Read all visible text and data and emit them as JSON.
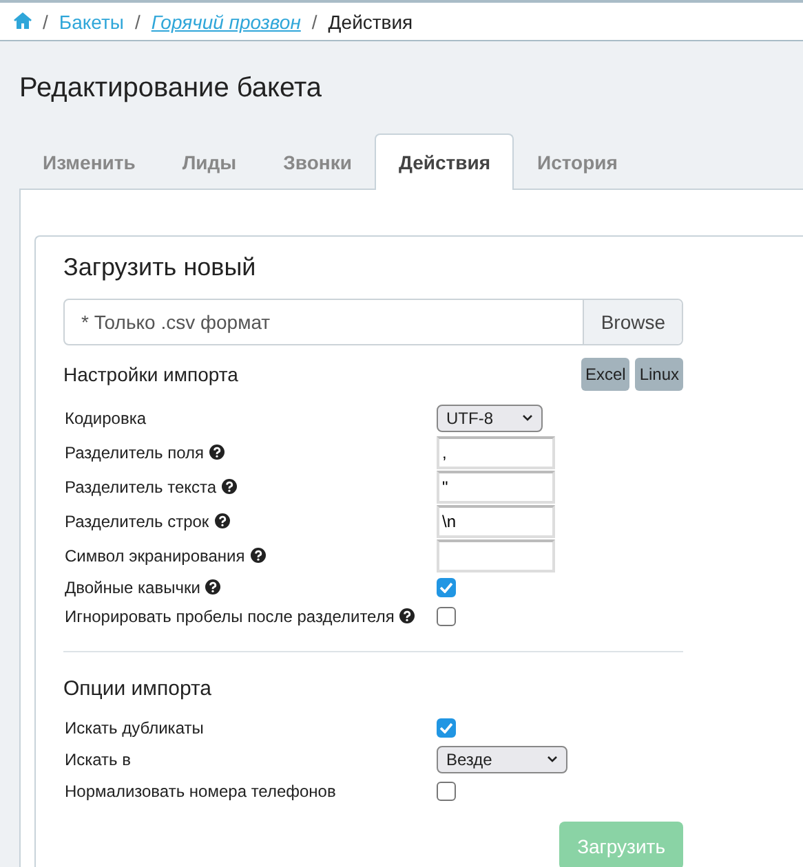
{
  "breadcrumb": [
    {
      "kind": "home"
    },
    {
      "kind": "separator",
      "label": "/"
    },
    {
      "kind": "link",
      "label": "Бакеты"
    },
    {
      "kind": "separator",
      "label": "/"
    },
    {
      "kind": "italic-link",
      "label": "Горячий прозвон"
    },
    {
      "kind": "separator",
      "label": "/"
    },
    {
      "kind": "current",
      "label": "Действия"
    }
  ],
  "title": "Редактирование бакета",
  "tabs": [
    {
      "label": "Изменить",
      "selected": false
    },
    {
      "label": "Лиды",
      "selected": false
    },
    {
      "label": "Звонки",
      "selected": false
    },
    {
      "label": "Действия",
      "selected": true
    },
    {
      "label": "История",
      "selected": false
    }
  ],
  "upload": {
    "heading": "Загрузить новый",
    "file_placeholder": "* Только .csv формат",
    "browse_button": "Browse"
  },
  "settings": {
    "heading": "Настройки импорта",
    "presets": [
      "Excel",
      "Linux"
    ],
    "rows": [
      {
        "kind": "select",
        "label": "Кодировка",
        "help": false,
        "value": "UTF-8"
      },
      {
        "kind": "text",
        "label": "Разделитель поля",
        "help": true,
        "value": ","
      },
      {
        "kind": "text",
        "label": "Разделитель текста",
        "help": true,
        "value": "\""
      },
      {
        "kind": "text",
        "label": "Разделитель строк",
        "help": true,
        "value": "\\n"
      },
      {
        "kind": "text",
        "label": "Символ экранирования",
        "help": true
      },
      {
        "kind": "checkbox",
        "label": "Двойные кавычки",
        "help": true,
        "checked": true
      },
      {
        "kind": "checkbox",
        "label": "Игнорировать пробелы после разделителя",
        "help": true,
        "checked": false
      }
    ]
  },
  "options": {
    "heading": "Опции импорта",
    "rows": [
      {
        "kind": "checkbox",
        "label": "Искать дубликаты",
        "help": false,
        "checked": true
      },
      {
        "kind": "select",
        "label": "Искать в",
        "help": false,
        "value": "Везде",
        "wide": true
      },
      {
        "kind": "checkbox",
        "label": "Нормализовать номера телефонов",
        "help": false,
        "checked": false
      }
    ]
  },
  "submit": {
    "label": "Загрузить",
    "disabled": true
  }
}
